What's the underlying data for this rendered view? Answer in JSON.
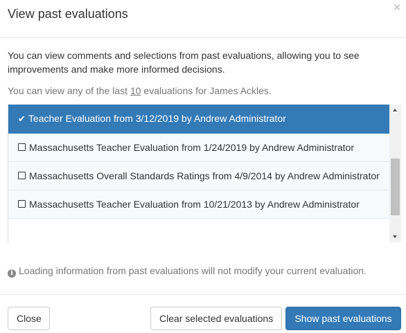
{
  "modal": {
    "title": "View past evaluations",
    "close_symbol": "×"
  },
  "intro": {
    "text": "You can view comments and selections from past evaluations, allowing you to see improvements and make more informed decisions.",
    "last_prefix": "You can view any of the last ",
    "last_count": "10",
    "last_suffix": " evaluations for James Ackles."
  },
  "evaluations": [
    {
      "label": "Teacher Evaluation from 3/12/2019 by Andrew Administrator",
      "selected": true
    },
    {
      "label": "Massachusetts Teacher Evaluation from 1/24/2019 by Andrew Administrator",
      "selected": false
    },
    {
      "label": "Massachusetts Overall Standards Ratings from 4/9/2014 by Andrew Administrator",
      "selected": false
    },
    {
      "label": "Massachusetts Teacher Evaluation from 10/21/2013 by Andrew Administrator",
      "selected": false
    }
  ],
  "info": {
    "icon": "info-circle-icon",
    "text": "Loading information from past evaluations will not modify your current evaluation."
  },
  "footer": {
    "close_label": "Close",
    "clear_label": "Clear selected evaluations",
    "show_label": "Show past evaluations"
  },
  "colors": {
    "primary": "#337ab7",
    "muted_text": "#777777",
    "list_background": "#f7fafd"
  }
}
